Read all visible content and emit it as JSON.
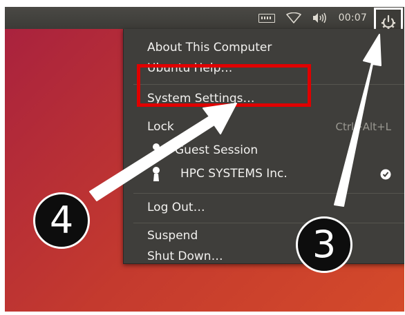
{
  "panel": {
    "clock": "00:07",
    "indicators": [
      "keyboard-icon",
      "wifi-icon",
      "volume-icon",
      "gear-icon"
    ]
  },
  "menu": {
    "about": "About This Computer",
    "help": "Ubuntu Help…",
    "settings": "System Settings…",
    "lock": "Lock",
    "lock_shortcut": "Ctrl+Alt+L",
    "guest": "Guest Session",
    "user": "HPC SYSTEMS Inc.",
    "logout": "Log Out…",
    "suspend": "Suspend",
    "shutdown": "Shut Down…"
  },
  "annotations": {
    "step3": "3",
    "step4": "4",
    "highlight_color": "#e00000",
    "arrow_color": "#ffffff"
  }
}
